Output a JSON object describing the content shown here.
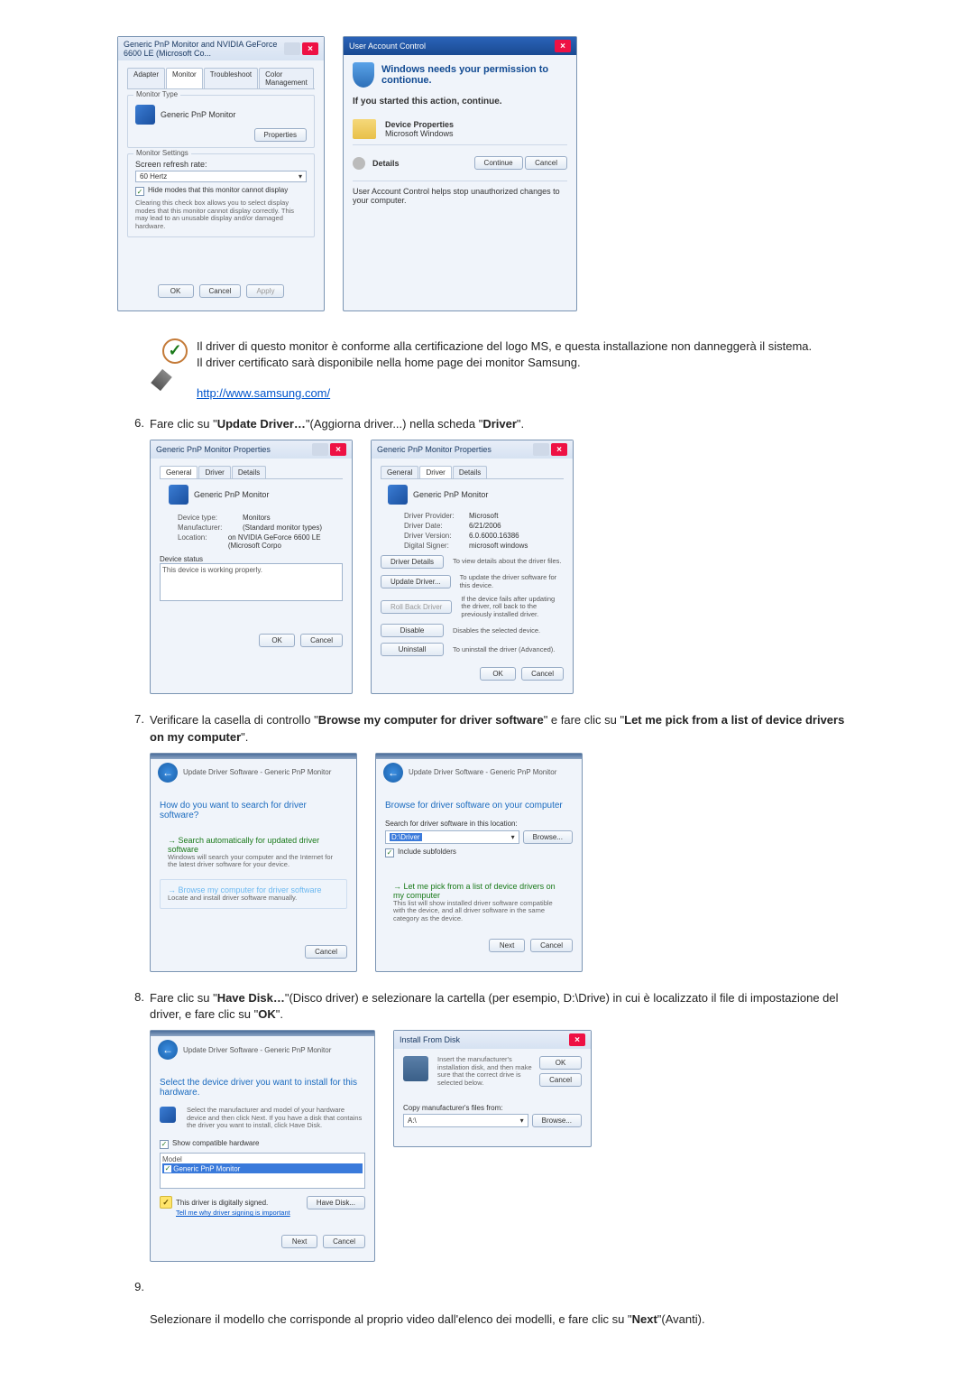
{
  "monitor_props": {
    "title": "Generic PnP Monitor and NVIDIA GeForce 6600 LE (Microsoft Co...",
    "tabs": [
      "Adapter",
      "Monitor",
      "Troubleshoot",
      "Color Management"
    ],
    "monitor_type_label": "Monitor Type",
    "monitor_type": "Generic PnP Monitor",
    "properties_btn": "Properties",
    "monitor_settings_label": "Monitor Settings",
    "refresh_label": "Screen refresh rate:",
    "refresh_value": "60 Hertz",
    "hide_modes": "Hide modes that this monitor cannot display",
    "hide_modes_note": "Clearing this check box allows you to select display modes that this monitor cannot display correctly. This may lead to an unusable display and/or damaged hardware.",
    "ok": "OK",
    "cancel": "Cancel",
    "apply": "Apply"
  },
  "uac": {
    "title": "User Account Control",
    "headline": "Windows needs your permission to contionue.",
    "sub": "If you started this action, continue.",
    "dp": "Device Properties",
    "mw": "Microsoft Windows",
    "details": "Details",
    "continue": "Continue",
    "cancel": "Cancel",
    "footer": "User Account Control helps stop unauthorized changes to your computer."
  },
  "note": {
    "l1": "Il driver di questo monitor è conforme alla certificazione del logo MS, e questa installazione non danneggerà il sistema.",
    "l2": "Il driver certificato sarà disponibile nella home page dei monitor Samsung.",
    "link": "http://www.samsung.com/"
  },
  "step6": {
    "num": "6.",
    "t1": "Fare clic su \"",
    "b1": "Update Driver…",
    "t2": "\"(Aggiorna driver...) nella scheda \"",
    "b2": "Driver",
    "t3": "\"."
  },
  "gen_props": {
    "title": "Generic PnP Monitor Properties",
    "tabs": [
      "General",
      "Driver",
      "Details"
    ],
    "device": "Generic PnP Monitor",
    "rows": {
      "dt_l": "Device type:",
      "dt_v": "Monitors",
      "mf_l": "Manufacturer:",
      "mf_v": "(Standard monitor types)",
      "lo_l": "Location:",
      "lo_v": "on NVIDIA GeForce 6600 LE (Microsoft Corpo"
    },
    "ds_label": "Device status",
    "ds_value": "This device is working properly.",
    "ok": "OK",
    "cancel": "Cancel"
  },
  "drv_props": {
    "title": "Generic PnP Monitor Properties",
    "tabs": [
      "General",
      "Driver",
      "Details"
    ],
    "device": "Generic PnP Monitor",
    "rows": {
      "dp_l": "Driver Provider:",
      "dp_v": "Microsoft",
      "dd_l": "Driver Date:",
      "dd_v": "6/21/2006",
      "dv_l": "Driver Version:",
      "dv_v": "6.0.6000.16386",
      "ds_l": "Digital Signer:",
      "ds_v": "microsoft windows"
    },
    "b1": "Driver Details",
    "d1": "To view details about the driver files.",
    "b2": "Update Driver...",
    "d2": "To update the driver software for this device.",
    "b3": "Roll Back Driver",
    "d3": "If the device fails after updating the driver, roll back to the previously installed driver.",
    "b4": "Disable",
    "d4": "Disables the selected device.",
    "b5": "Uninstall",
    "d5": "To uninstall the driver (Advanced).",
    "ok": "OK",
    "cancel": "Cancel"
  },
  "step7": {
    "num": "7.",
    "t1": "Verificare la casella di controllo \"",
    "b1": "Browse my computer for driver software",
    "t2": "\" e fare clic su \"",
    "b2": "Let me pick from a list of device drivers on my computer",
    "t3": "\"."
  },
  "wiz1": {
    "crumb": "Update Driver Software - Generic PnP Monitor",
    "title": "How do you want to search for driver software?",
    "o1t": "Search automatically for updated driver software",
    "o1d": "Windows will search your computer and the Internet for the latest driver software for your device.",
    "o2t": "Browse my computer for driver software",
    "o2d": "Locate and install driver software manually.",
    "cancel": "Cancel"
  },
  "wiz2": {
    "crumb": "Update Driver Software - Generic PnP Monitor",
    "title": "Browse for driver software on your computer",
    "searchlbl": "Search for driver software in this location:",
    "path": "D:\\Driver",
    "browse": "Browse...",
    "include": "Include subfolders",
    "o1t": "Let me pick from a list of device drivers on my computer",
    "o1d": "This list will show installed driver software compatible with the device, and all driver software in the same category as the device.",
    "next": "Next",
    "cancel": "Cancel"
  },
  "step8": {
    "num": "8.",
    "t1": "Fare clic su \"",
    "b1": "Have Disk…",
    "t2": "\"(Disco driver) e selezionare la cartella (per esempio, D:\\Drive) in cui è localizzato il file di impostazione del driver, e fare clic su \"",
    "b2": "OK",
    "t3": "\"."
  },
  "wiz3": {
    "crumb": "Update Driver Software - Generic PnP Monitor",
    "title": "Select the device driver you want to install for this hardware.",
    "note": "Select the manufacturer and model of your hardware device and then click Next. If you have a disk that contains the driver you want to install, click Have Disk.",
    "chk": "Show compatible hardware",
    "model_l": "Model",
    "model_v": "Generic PnP Monitor",
    "signed": "This driver is digitally signed.",
    "tell": "Tell me why driver signing is important",
    "havedisk": "Have Disk...",
    "next": "Next",
    "cancel": "Cancel"
  },
  "ifd": {
    "title": "Install From Disk",
    "msg": "Insert the manufacturer's installation disk, and then make sure that the correct drive is selected below.",
    "ok": "OK",
    "cancel": "Cancel",
    "copy": "Copy manufacturer's files from:",
    "path": "A:\\",
    "browse": "Browse..."
  },
  "step9": {
    "num": "9.",
    "body": "Selezionare il modello che corrisponde al proprio video dall'elenco dei modelli, e fare clic su \"",
    "b1": "Next",
    "t2": "\"(Avanti)."
  }
}
